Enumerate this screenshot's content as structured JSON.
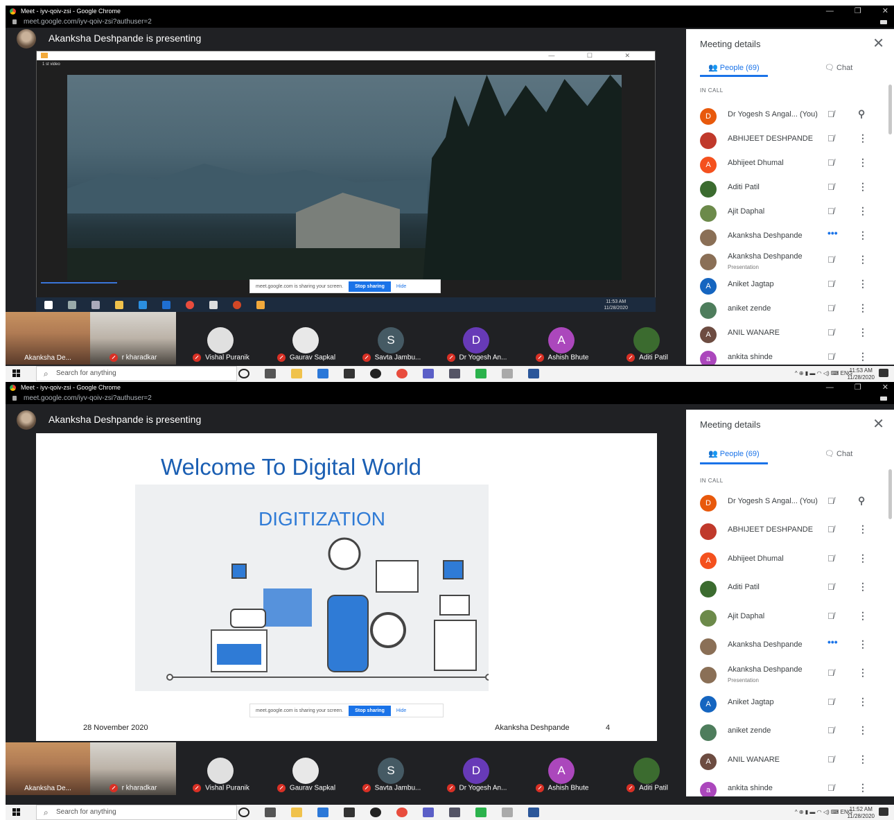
{
  "browser": {
    "window_title": "Meet - iyv-qoiv-zsi - Google Chrome",
    "url": "meet.google.com/iyv-qoiv-zsi?authuser=2"
  },
  "presenter_text": "Akanksha Deshpande is presenting",
  "video_window": {
    "caption": "1 st video",
    "inner_clock_time": "11:53 AM",
    "inner_clock_date": "11/28/2020"
  },
  "share_bar": {
    "message": "meet.google.com is sharing your screen.",
    "stop_label": "Stop sharing",
    "hide_label": "Hide"
  },
  "slide": {
    "title": "Welcome To Digital World",
    "graphic_heading": "DIGITIZATION",
    "footer_date": "28 November 2020",
    "footer_author": "Akanksha Deshpande",
    "page_number": "4"
  },
  "panel": {
    "title": "Meeting details",
    "close": "✕",
    "people_tab": "People (69)",
    "chat_tab": "Chat",
    "in_call": "IN CALL",
    "participants": [
      {
        "initial": "D",
        "name": "Dr Yogesh S Angal...  (You)",
        "color": "#e8590c"
      },
      {
        "initial": "",
        "name": "ABHIJEET DESHPANDE",
        "color": "#c0392b"
      },
      {
        "initial": "A",
        "name": "Abhijeet Dhumal",
        "color": "#f4511e"
      },
      {
        "initial": "",
        "name": "Aditi Patil",
        "color": "#3b6b2f"
      },
      {
        "initial": "",
        "name": "Ajit Daphal",
        "color": "#6c8a4a"
      },
      {
        "initial": "",
        "name": "Akanksha Deshpande",
        "color": "#8a6f56"
      },
      {
        "initial": "",
        "name": "Akanksha Deshpande",
        "sub": "Presentation",
        "color": "#8a6f56"
      },
      {
        "initial": "A",
        "name": "Aniket Jagtap",
        "color": "#1565c0"
      },
      {
        "initial": "",
        "name": "aniket zende",
        "color": "#4e7d5c"
      },
      {
        "initial": "A",
        "name": "ANIL WANARE",
        "color": "#6d4c41"
      },
      {
        "initial": "a",
        "name": "ankita shinde",
        "color": "#ab47bc"
      }
    ]
  },
  "strip": {
    "self_name": "Akanksha De...",
    "cam2_name": "r kharadkar",
    "tiles": [
      {
        "initial": "",
        "name": "Vishal Puranik",
        "color": "#e0e0e0"
      },
      {
        "initial": "",
        "name": "Gaurav Sapkal",
        "color": "#e8e8e8"
      },
      {
        "initial": "S",
        "name": "Savta Jambu...",
        "color": "#455a64"
      },
      {
        "initial": "D",
        "name": "Dr Yogesh An...",
        "color": "#673ab7"
      },
      {
        "initial": "A",
        "name": "Ashish Bhute",
        "color": "#ab47bc"
      },
      {
        "initial": "",
        "name": "Aditi Patil",
        "color": "#3b6b2f"
      }
    ]
  },
  "taskbar": {
    "search_placeholder": "Search for anything",
    "lang": "ENG",
    "time_top": "11:53 AM",
    "time_bottom": "11:52 AM",
    "date": "11/28/2020"
  }
}
